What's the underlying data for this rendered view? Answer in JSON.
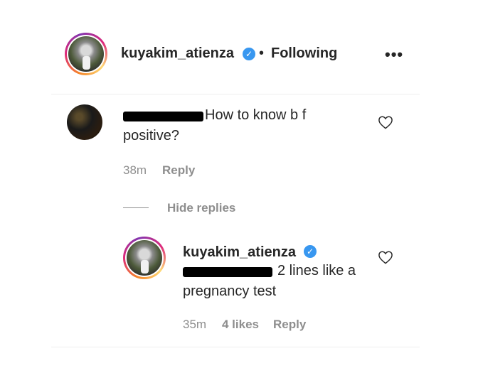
{
  "header": {
    "username": "kuyakim_atienza",
    "separator": "•",
    "follow_status": "Following",
    "more_label": "•••"
  },
  "comment": {
    "text_line1": "How to know b f",
    "text_line2": "positive?",
    "time": "38m",
    "reply_label": "Reply"
  },
  "replies_toggle": {
    "label": "Hide replies"
  },
  "reply": {
    "username": "kuyakim_atienza",
    "text_line1": "2 lines like a",
    "text_line2": "pregnancy test",
    "time": "35m",
    "likes": "4 likes",
    "reply_label": "Reply"
  },
  "icons": {
    "verified": "verified-badge-icon",
    "heart": "heart-outline-icon",
    "more": "more-options-icon"
  },
  "colors": {
    "verified": "#3897f0",
    "muted": "#8e8e8e",
    "text": "#262626"
  }
}
